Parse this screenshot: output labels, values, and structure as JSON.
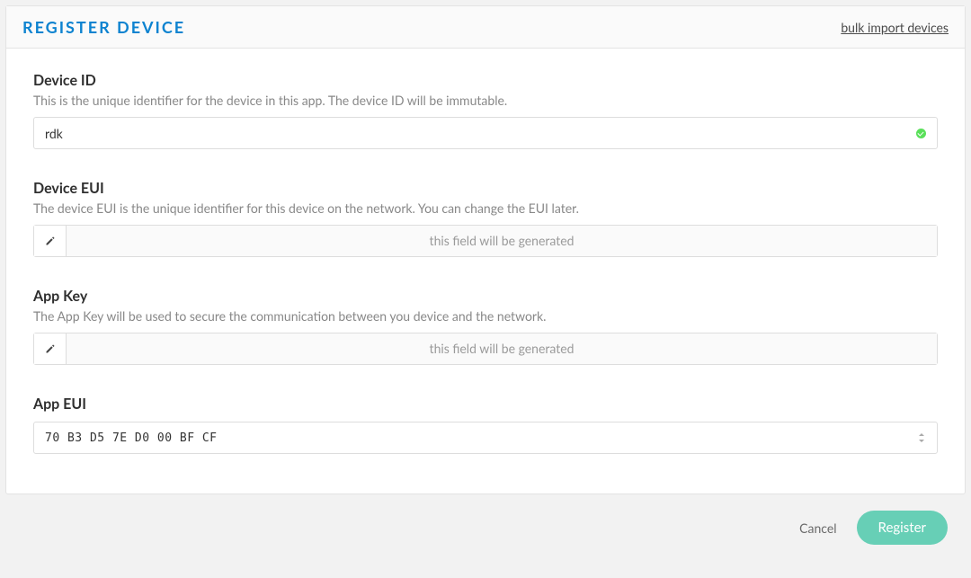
{
  "header": {
    "title": "REGISTER DEVICE",
    "bulk_link": "bulk import devices"
  },
  "device_id": {
    "label": "Device ID",
    "description": "This is the unique identifier for the device in this app. The device ID will be immutable.",
    "value": "rdk"
  },
  "device_eui": {
    "label": "Device EUI",
    "description": "The device EUI is the unique identifier for this device on the network. You can change the EUI later.",
    "placeholder": "this field will be generated"
  },
  "app_key": {
    "label": "App Key",
    "description": "The App Key will be used to secure the communication between you device and the network.",
    "placeholder": "this field will be generated"
  },
  "app_eui": {
    "label": "App EUI",
    "value": "70 B3 D5 7E D0 00 BF CF"
  },
  "footer": {
    "cancel": "Cancel",
    "register": "Register"
  }
}
